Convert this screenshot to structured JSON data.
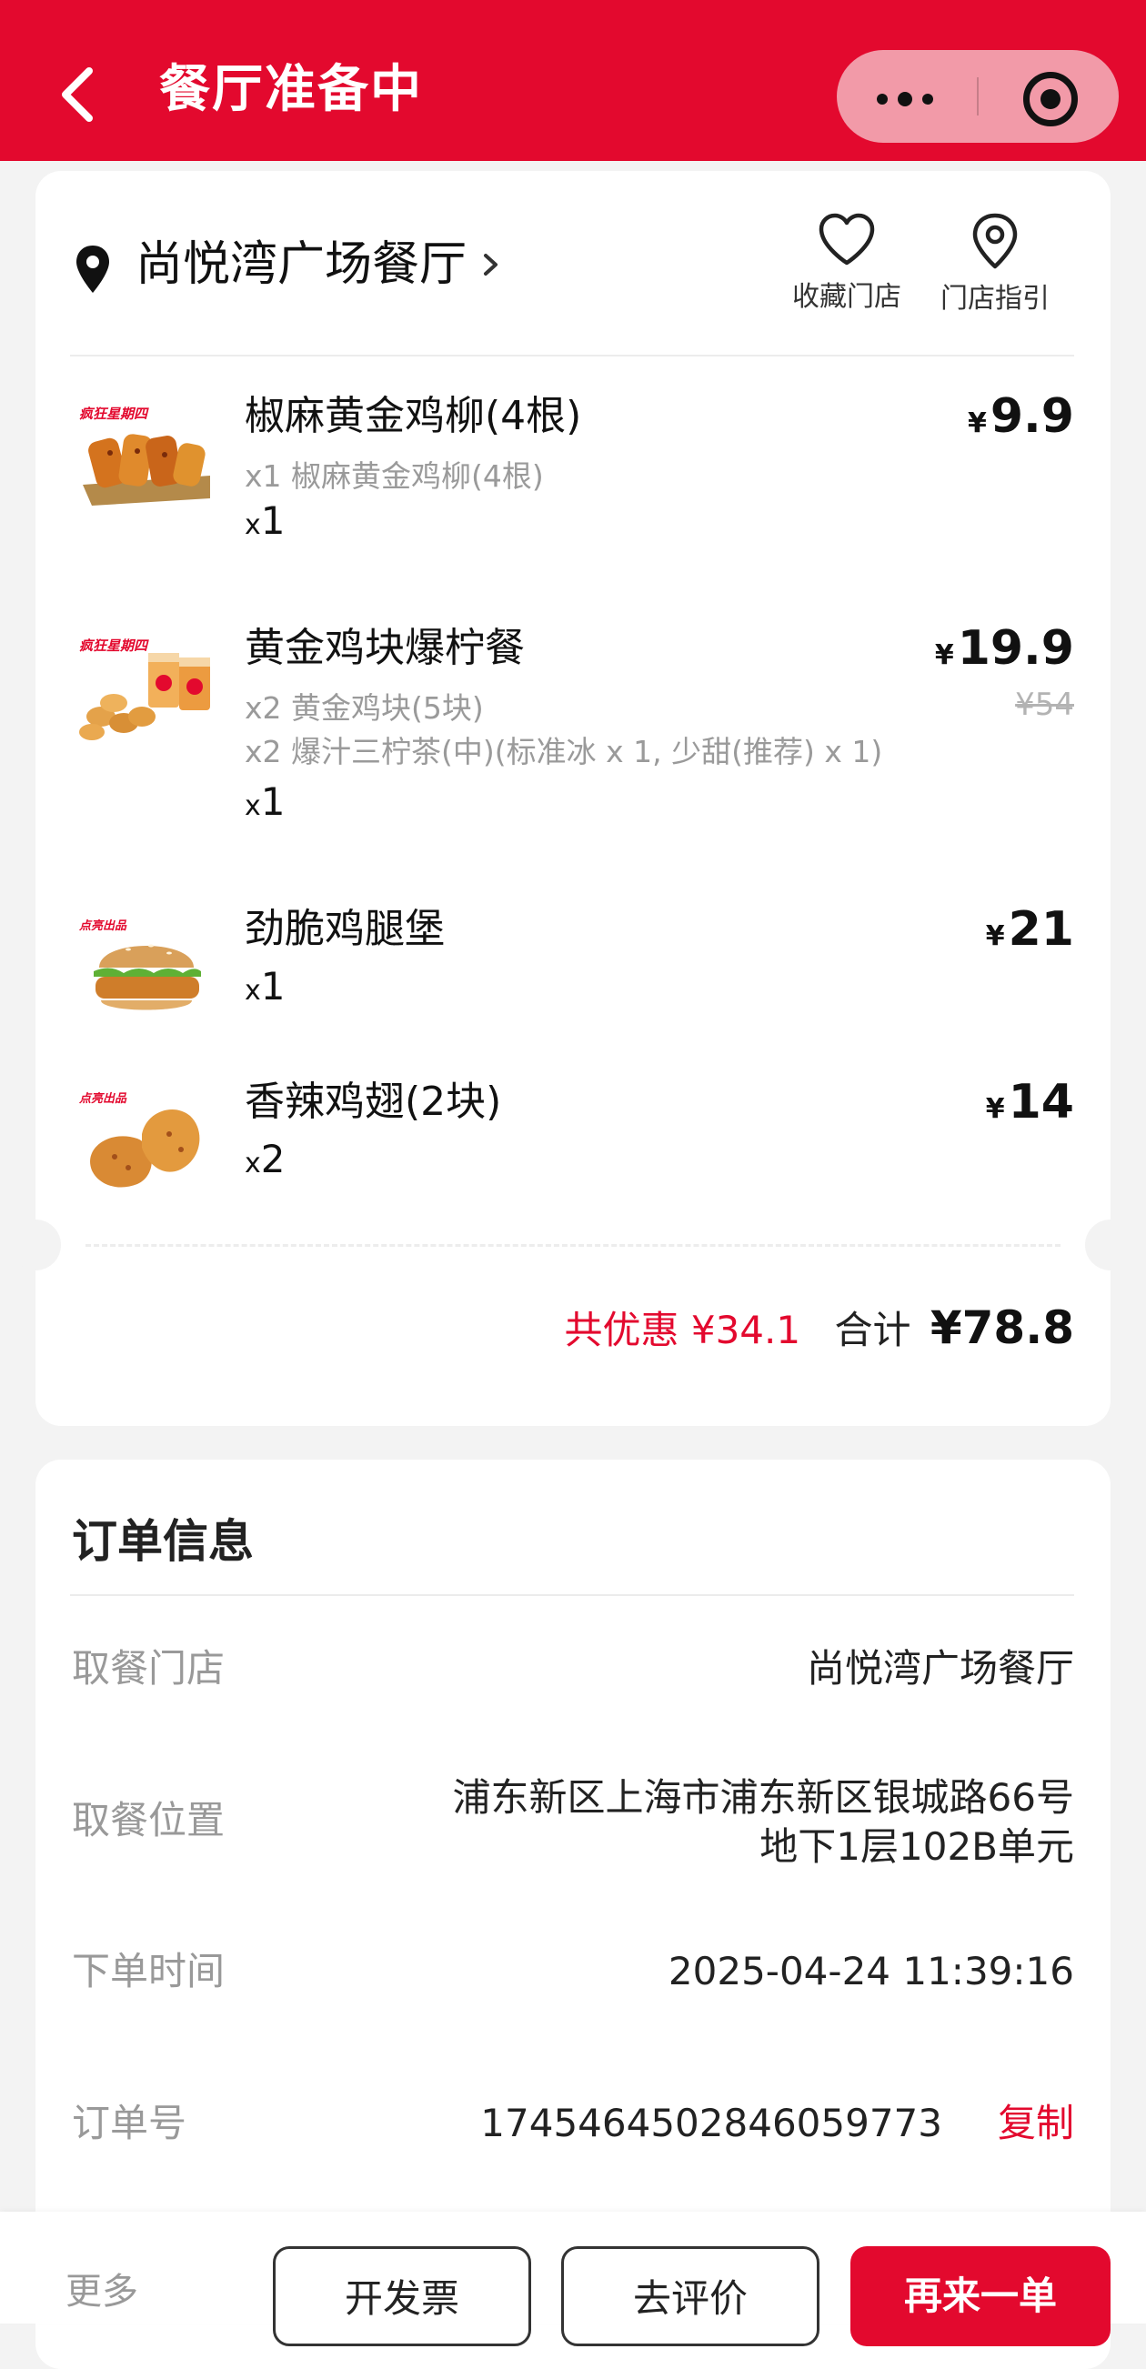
{
  "header": {
    "title": "餐厅准备中"
  },
  "store": {
    "name": "尚悦湾广场餐厅",
    "favorite_label": "收藏门店",
    "guide_label": "门店指引"
  },
  "items": [
    {
      "name": "椒麻黄金鸡柳(4根)",
      "details": [
        "x1 椒麻黄金鸡柳(4根)"
      ],
      "qty": "1",
      "price": "9.9",
      "orig_price": ""
    },
    {
      "name": "黄金鸡块爆柠餐",
      "details": [
        "x2 黄金鸡块(5块)",
        "x2 爆汁三柠茶(中)(标准冰 x 1, 少甜(推荐) x 1)"
      ],
      "qty": "1",
      "price": "19.9",
      "orig_price": "¥54"
    },
    {
      "name": "劲脆鸡腿堡",
      "details": [],
      "qty": "1",
      "price": "21",
      "orig_price": ""
    },
    {
      "name": "香辣鸡翅(2块)",
      "details": [],
      "qty": "2",
      "price": "14",
      "orig_price": ""
    }
  ],
  "currency": "¥",
  "qty_prefix": "x",
  "summary": {
    "discount_text": "共优惠 ¥34.1",
    "total_label": "合计",
    "total_value": "¥78.8"
  },
  "order_info": {
    "title": "订单信息",
    "store_label": "取餐门店",
    "store_value": "尚悦湾广场餐厅",
    "location_label": "取餐位置",
    "location_line1": "浦东新区上海市浦东新区银城路66号",
    "location_line2": "地下1层102B单元",
    "time_label": "下单时间",
    "time_value": "2025-04-24 11:39:16",
    "order_no_label": "订单号",
    "order_no_value": "1745464502846059773",
    "copy_label": "复制"
  },
  "bottom_bar": {
    "more_label": "更多",
    "invoice_label": "开发票",
    "review_label": "去评价",
    "reorder_label": "再来一单"
  },
  "colors": {
    "brand_red": "#e3092e"
  }
}
